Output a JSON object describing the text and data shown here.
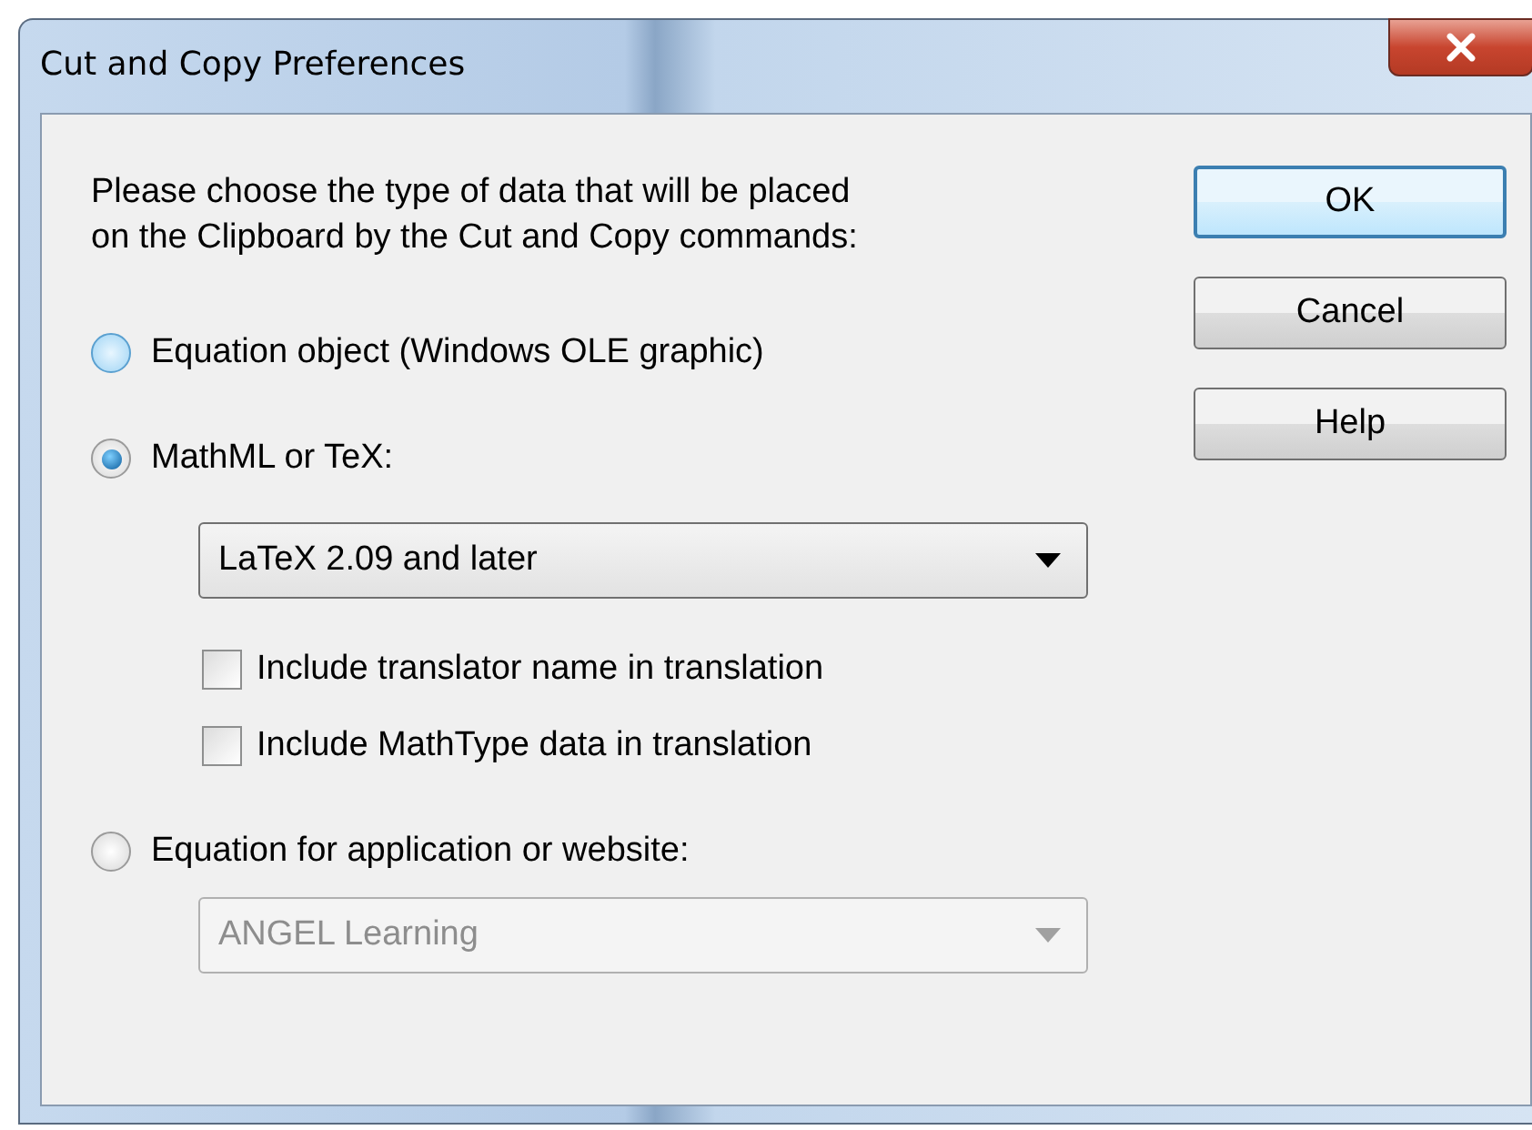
{
  "window": {
    "title": "Cut and Copy Preferences"
  },
  "prompt": "Please choose the type of data that will be placed\non the Clipboard by the Cut and Copy commands:",
  "options": [
    {
      "label": "Equation object (Windows OLE graphic)",
      "selected": false
    },
    {
      "label": "MathML or TeX:",
      "selected": true,
      "dropdown": {
        "value": "LaTeX 2.09 and later",
        "disabled": false
      },
      "checkboxes": [
        {
          "label": "Include translator name in translation",
          "checked": false
        },
        {
          "label": "Include MathType data in translation",
          "checked": false
        }
      ]
    },
    {
      "label": "Equation for application or website:",
      "selected": false,
      "dropdown": {
        "value": "ANGEL Learning",
        "disabled": true
      }
    }
  ],
  "buttons": [
    {
      "label": "OK",
      "default": true
    },
    {
      "label": "Cancel",
      "default": false
    },
    {
      "label": "Help",
      "default": false
    }
  ]
}
